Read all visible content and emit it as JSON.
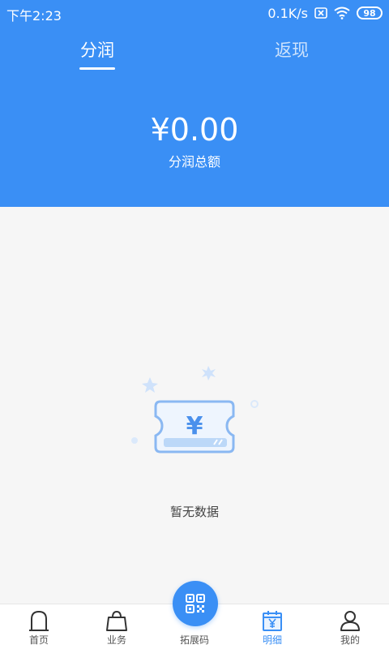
{
  "status_bar": {
    "time": "下午2:23",
    "network_speed": "0.1K/s",
    "battery": "98",
    "icons": [
      "no-sim-icon",
      "wifi-icon",
      "battery-icon"
    ]
  },
  "header": {
    "tabs": [
      {
        "label": "分润",
        "active": true
      },
      {
        "label": "返现",
        "active": false
      }
    ],
    "total_amount": "¥0.00",
    "total_label": "分润总额",
    "background_color": "#3a8ff5"
  },
  "empty_state": {
    "icon": "ticket-yen-icon",
    "text": "暂无数据"
  },
  "bottom_nav": {
    "items": [
      {
        "label": "首页",
        "icon": "home-icon",
        "active": false
      },
      {
        "label": "业务",
        "icon": "bag-icon",
        "active": false
      },
      {
        "label": "拓展码",
        "icon": "qr-code-icon",
        "active": false
      },
      {
        "label": "明细",
        "icon": "calendar-yen-icon",
        "active": true
      },
      {
        "label": "我的",
        "icon": "user-icon",
        "active": false
      }
    ],
    "active_color": "#3a8ff5"
  }
}
